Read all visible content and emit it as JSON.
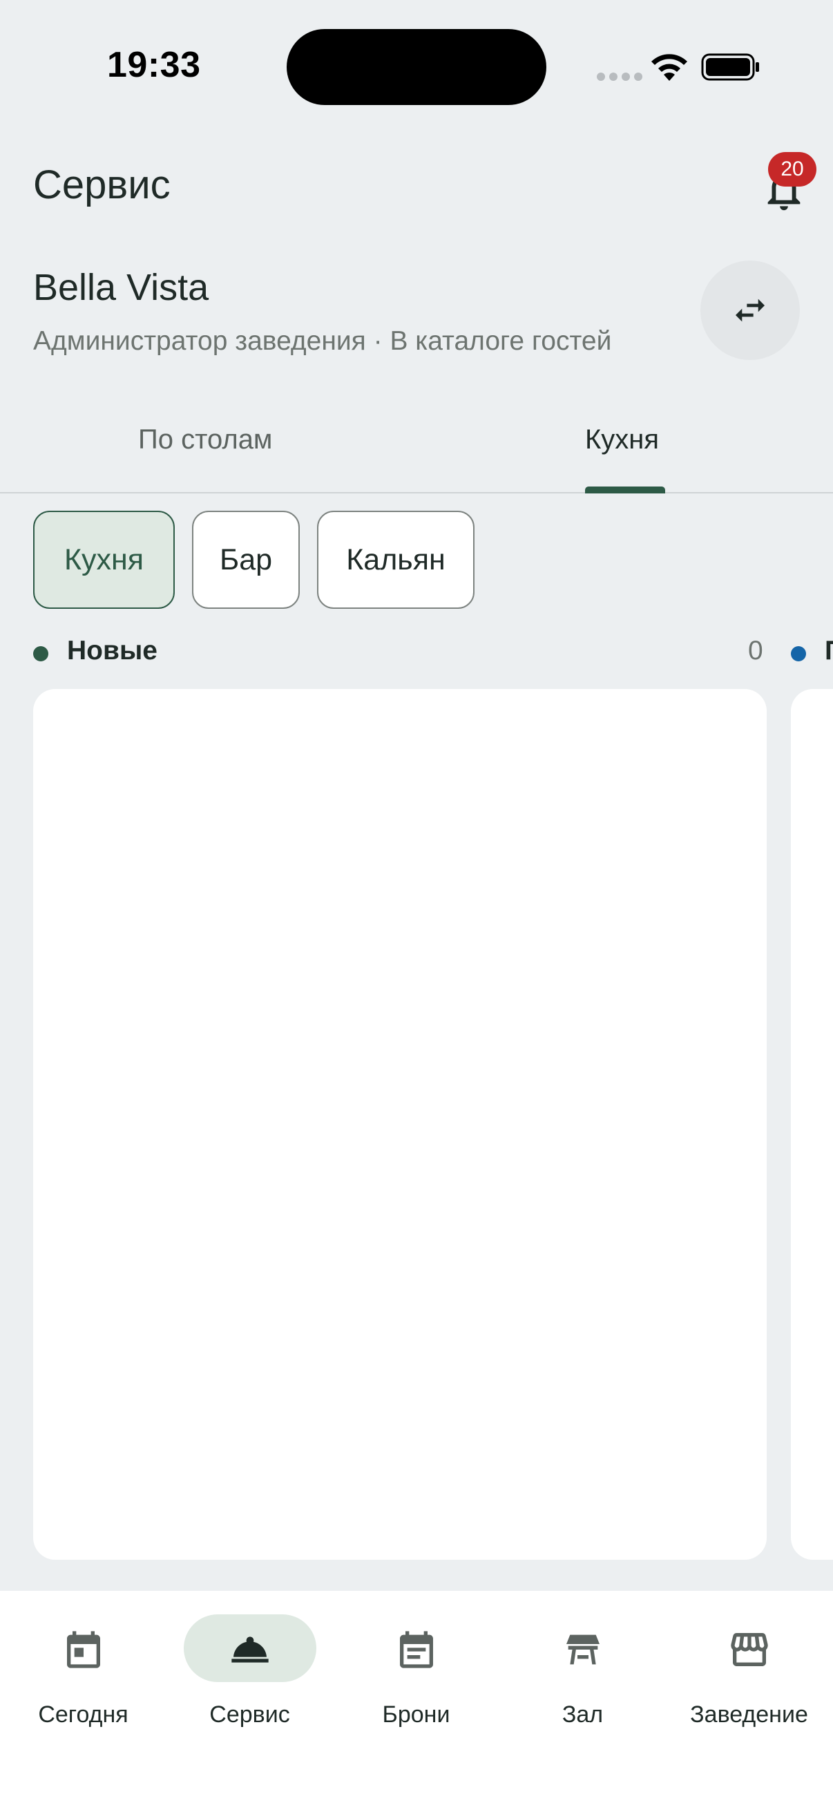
{
  "status_bar": {
    "time": "19:33"
  },
  "header": {
    "title": "Сервис",
    "notifications_count": "20",
    "venue_name": "Bella Vista",
    "venue_subtitle": "Администратор заведения · В каталоге гостей"
  },
  "tabs": [
    {
      "label": "По столам",
      "selected": false
    },
    {
      "label": "Кухня",
      "selected": true
    }
  ],
  "filters": [
    {
      "label": "Кухня",
      "selected": true
    },
    {
      "label": "Бар",
      "selected": false
    },
    {
      "label": "Кальян",
      "selected": false
    }
  ],
  "columns": [
    {
      "title": "Новые",
      "count": "0",
      "color": "#2d5a46"
    },
    {
      "title": "П",
      "color": "#1565a8"
    }
  ],
  "bottom_nav": [
    {
      "label": "Сегодня",
      "icon": "calendar-today-icon",
      "selected": false
    },
    {
      "label": "Сервис",
      "icon": "room-service-icon",
      "selected": true
    },
    {
      "label": "Брони",
      "icon": "reservations-icon",
      "selected": false
    },
    {
      "label": "Зал",
      "icon": "table-icon",
      "selected": false
    },
    {
      "label": "Заведение",
      "icon": "store-icon",
      "selected": false
    }
  ],
  "colors": {
    "accent": "#2d5a46",
    "badge": "#c62828",
    "background": "#eceff1"
  }
}
